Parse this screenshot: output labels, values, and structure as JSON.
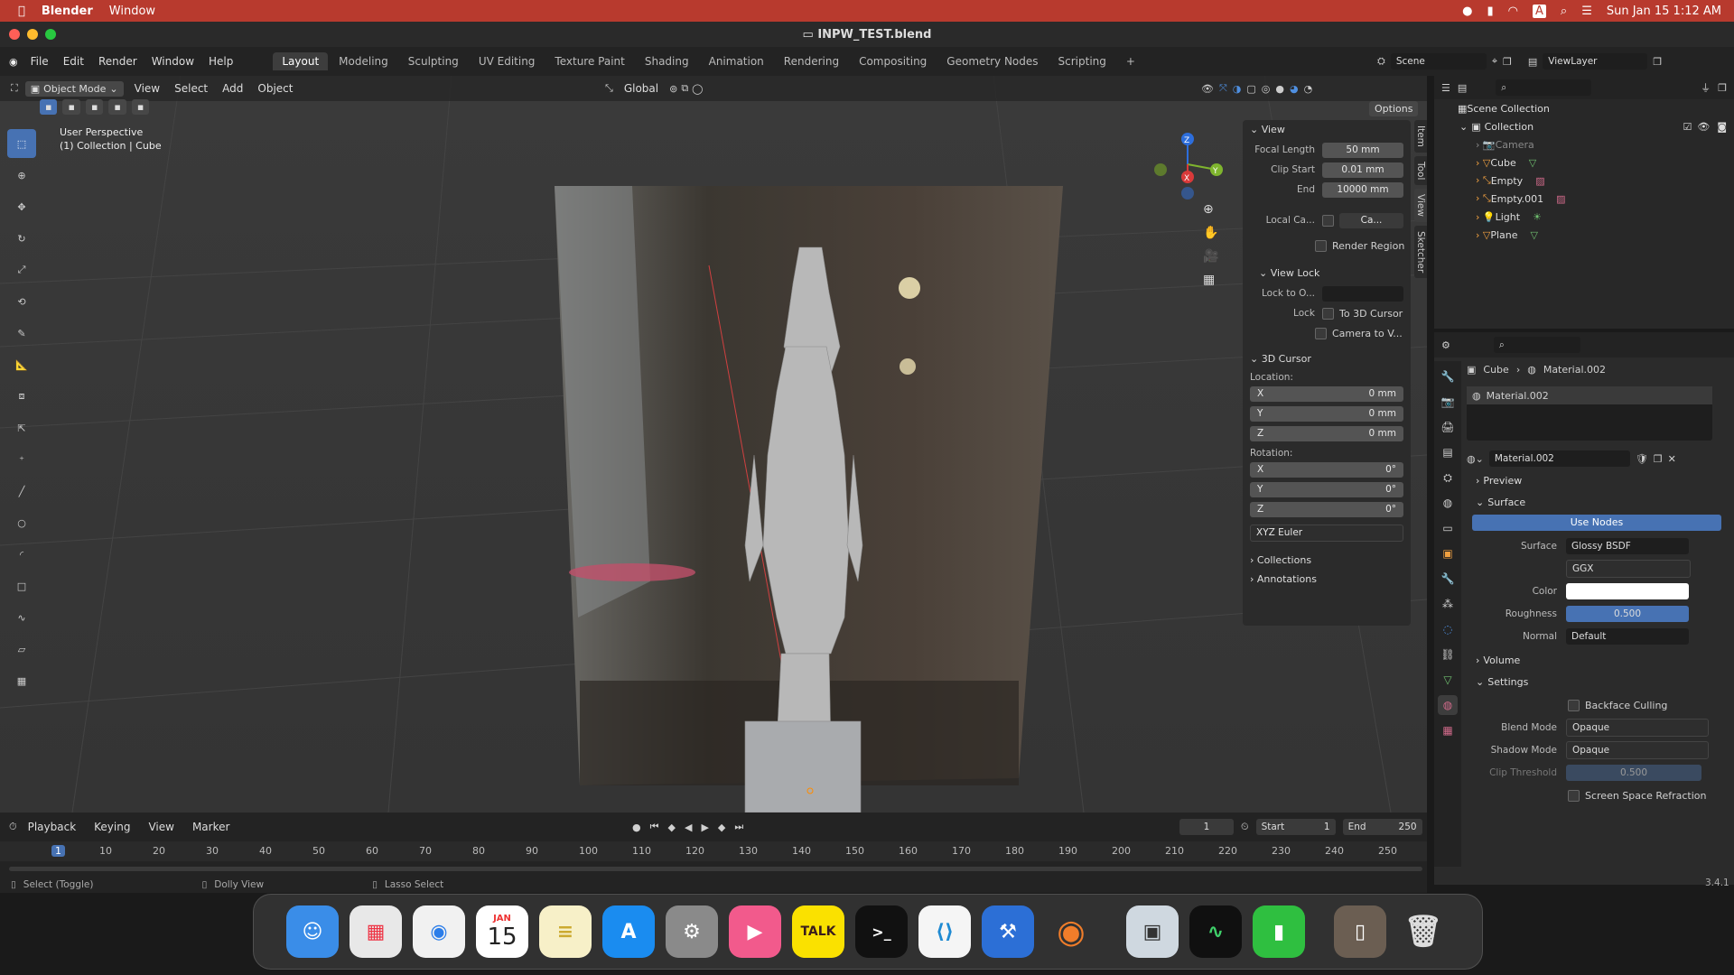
{
  "mac_menubar": {
    "app": "Blender",
    "menu": "Window",
    "datetime": "Sun Jan 15  1:12 AM",
    "input_indicator": "A"
  },
  "window": {
    "title": "INPW_TEST.blend"
  },
  "topbar": {
    "menus": [
      "File",
      "Edit",
      "Render",
      "Window",
      "Help"
    ],
    "workspaces": [
      "Layout",
      "Modeling",
      "Sculpting",
      "UV Editing",
      "Texture Paint",
      "Shading",
      "Animation",
      "Rendering",
      "Compositing",
      "Geometry Nodes",
      "Scripting"
    ],
    "active_workspace": "Layout",
    "scene": "Scene",
    "view_layer": "ViewLayer"
  },
  "viewport_header": {
    "mode": "Object Mode",
    "menus": [
      "View",
      "Select",
      "Add",
      "Object"
    ],
    "orientation": "Global",
    "options": "Options"
  },
  "viewport": {
    "perspective": "User Perspective",
    "collection_info": "(1) Collection | Cube"
  },
  "npanel": {
    "view_title": "View",
    "focal_length_label": "Focal Length",
    "focal_length": "50 mm",
    "clip_start_label": "Clip Start",
    "clip_start": "0.01 mm",
    "clip_end_label": "End",
    "clip_end": "10000 mm",
    "local_camera_label": "Local Ca...",
    "local_camera_value": "Ca...",
    "render_region": "Render Region",
    "view_lock_title": "View Lock",
    "lock_to_object_label": "Lock to O...",
    "lock_label": "Lock",
    "to_3d_cursor": "To 3D Cursor",
    "camera_to_view": "Camera to V...",
    "cursor_title": "3D Cursor",
    "location_label": "Location:",
    "loc_x": "0 mm",
    "loc_y": "0 mm",
    "loc_z": "0 mm",
    "rotation_label": "Rotation:",
    "rot_x": "0°",
    "rot_y": "0°",
    "rot_z": "0°",
    "rotation_mode": "XYZ Euler",
    "collections": "Collections",
    "annotations": "Annotations",
    "tabs": [
      "Item",
      "Tool",
      "View",
      "Sketcher"
    ]
  },
  "outliner": {
    "scene_collection": "Scene Collection",
    "collection": "Collection",
    "items": [
      "Camera",
      "Cube",
      "Empty",
      "Empty.001",
      "Light",
      "Plane"
    ]
  },
  "properties": {
    "breadcrumb_object": "Cube",
    "breadcrumb_material": "Material.002",
    "slot_material": "Material.002",
    "material_name": "Material.002",
    "preview": "Preview",
    "surface_section": "Surface",
    "use_nodes": "Use Nodes",
    "surface_label": "Surface",
    "surface_value": "Glossy BSDF",
    "distribution": "GGX",
    "color_label": "Color",
    "roughness_label": "Roughness",
    "roughness_value": "0.500",
    "normal_label": "Normal",
    "normal_value": "Default",
    "volume": "Volume",
    "settings": "Settings",
    "backface_culling": "Backface Culling",
    "blend_mode_label": "Blend Mode",
    "blend_mode": "Opaque",
    "shadow_mode_label": "Shadow Mode",
    "shadow_mode": "Opaque",
    "clip_threshold_label": "Clip Threshold",
    "clip_threshold": "0.500",
    "screen_space_refraction": "Screen Space Refraction"
  },
  "timeline": {
    "menus": [
      "Playback",
      "Keying",
      "View",
      "Marker"
    ],
    "current_frame": "1",
    "start_label": "Start",
    "start": "1",
    "end_label": "End",
    "end": "250",
    "ruler": [
      "1",
      "10",
      "20",
      "30",
      "40",
      "50",
      "60",
      "70",
      "80",
      "90",
      "100",
      "110",
      "120",
      "130",
      "140",
      "150",
      "160",
      "170",
      "180",
      "190",
      "200",
      "210",
      "220",
      "230",
      "240",
      "250"
    ]
  },
  "statusbar": {
    "select": "Select (Toggle)",
    "dolly": "Dolly View",
    "lasso": "Lasso Select",
    "version": "3.4.1"
  },
  "dock": {
    "calendar_month": "JAN",
    "calendar_day": "15",
    "talk_label": "TALK"
  },
  "colors": {
    "accent": "#4772b3",
    "menubar": "#b83a2e",
    "use_nodes_button": "#4772b3"
  }
}
